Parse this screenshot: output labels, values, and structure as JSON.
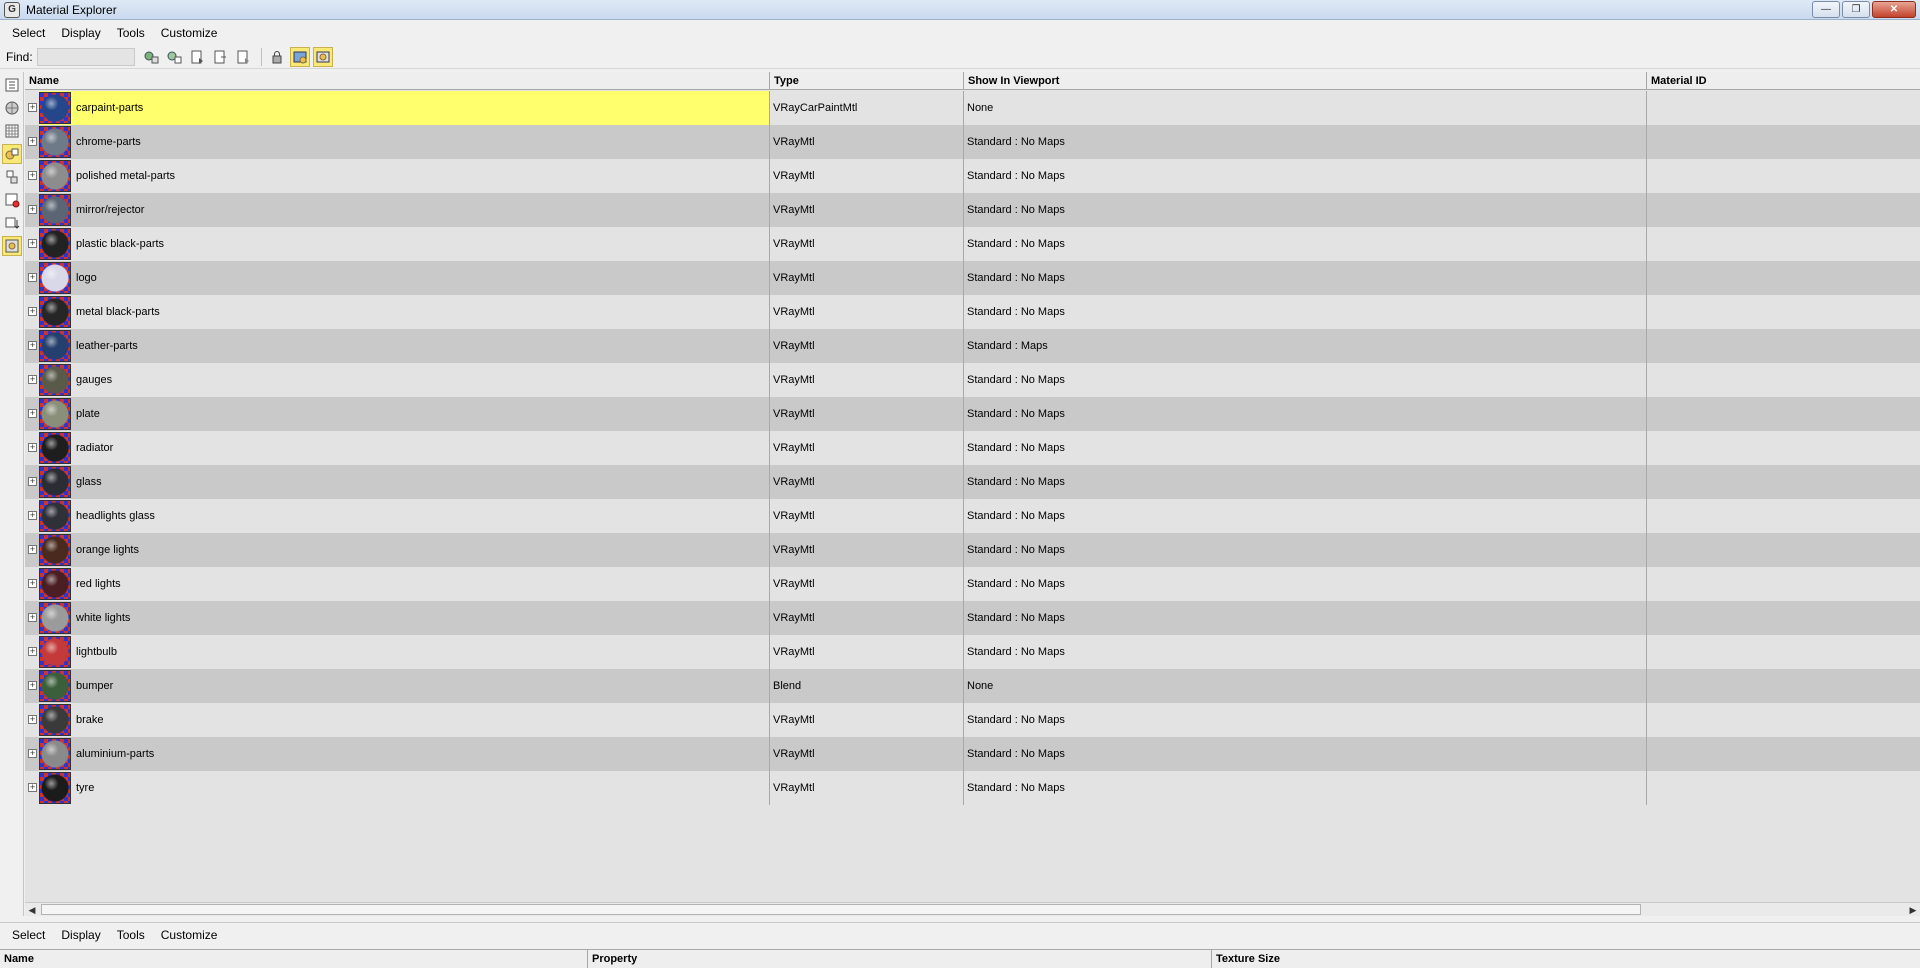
{
  "window": {
    "title": "Material Explorer",
    "minimize": "—",
    "restore": "❐",
    "close": "✕"
  },
  "menu": [
    "Select",
    "Display",
    "Tools",
    "Customize"
  ],
  "toolbar": {
    "find_label": "Find:",
    "find_value": ""
  },
  "columns": {
    "name": "Name",
    "type": "Type",
    "viewport": "Show In Viewport",
    "material_id": "Material ID"
  },
  "materials": [
    {
      "name": "carpaint-parts",
      "type": "VRayCarPaintMtl",
      "viewport": "None",
      "material_id": "",
      "selected": true,
      "swatch": "#24468a"
    },
    {
      "name": "chrome-parts",
      "type": "VRayMtl",
      "viewport": "Standard : No Maps",
      "material_id": "",
      "swatch": "#6f7a88"
    },
    {
      "name": "polished metal-parts",
      "type": "VRayMtl",
      "viewport": "Standard : No Maps",
      "material_id": "",
      "swatch": "#8d8d8d"
    },
    {
      "name": "mirror/rejector",
      "type": "VRayMtl",
      "viewport": "Standard : No Maps",
      "material_id": "",
      "swatch": "#5c6574"
    },
    {
      "name": "plastic black-parts",
      "type": "VRayMtl",
      "viewport": "Standard : No Maps",
      "material_id": "",
      "swatch": "#222222"
    },
    {
      "name": "logo",
      "type": "VRayMtl",
      "viewport": "Standard : No Maps",
      "material_id": "",
      "swatch": "#d8d8e8"
    },
    {
      "name": "metal black-parts",
      "type": "VRayMtl",
      "viewport": "Standard : No Maps",
      "material_id": "",
      "swatch": "#262626"
    },
    {
      "name": "leather-parts",
      "type": "VRayMtl",
      "viewport": "Standard : Maps",
      "material_id": "",
      "swatch": "#25406e"
    },
    {
      "name": "gauges",
      "type": "VRayMtl",
      "viewport": "Standard : No Maps",
      "material_id": "",
      "swatch": "#5a5a4a"
    },
    {
      "name": "plate",
      "type": "VRayMtl",
      "viewport": "Standard : No Maps",
      "material_id": "",
      "swatch": "#8a8f7a"
    },
    {
      "name": "radiator",
      "type": "VRayMtl",
      "viewport": "Standard : No Maps",
      "material_id": "",
      "swatch": "#1e1e1e"
    },
    {
      "name": "glass",
      "type": "VRayMtl",
      "viewport": "Standard : No Maps",
      "material_id": "",
      "swatch": "#2a2d33"
    },
    {
      "name": "headlights glass",
      "type": "VRayMtl",
      "viewport": "Standard : No Maps",
      "material_id": "",
      "swatch": "#2e3138"
    },
    {
      "name": "orange lights",
      "type": "VRayMtl",
      "viewport": "Standard : No Maps",
      "material_id": "",
      "swatch": "#4a2a1e"
    },
    {
      "name": "red lights",
      "type": "VRayMtl",
      "viewport": "Standard : No Maps",
      "material_id": "",
      "swatch": "#4a1e22"
    },
    {
      "name": "white lights",
      "type": "VRayMtl",
      "viewport": "Standard : No Maps",
      "material_id": "",
      "swatch": "#9b9b9b"
    },
    {
      "name": "lightbulb",
      "type": "VRayMtl",
      "viewport": "Standard : No Maps",
      "material_id": "",
      "swatch": "#c43a3a"
    },
    {
      "name": "bumper",
      "type": "Blend",
      "viewport": "None",
      "material_id": "",
      "swatch": "#3a5f3a"
    },
    {
      "name": "brake",
      "type": "VRayMtl",
      "viewport": "Standard : No Maps",
      "material_id": "",
      "swatch": "#3a3a3a"
    },
    {
      "name": "aluminium-parts",
      "type": "VRayMtl",
      "viewport": "Standard : No Maps",
      "material_id": "",
      "swatch": "#8a8a8a"
    },
    {
      "name": "tyre",
      "type": "VRayMtl",
      "viewport": "Standard : No Maps",
      "material_id": "",
      "swatch": "#1b1b1b"
    }
  ],
  "bottom": {
    "menu": [
      "Select",
      "Display",
      "Tools",
      "Customize"
    ],
    "columns": {
      "name": "Name",
      "property": "Property",
      "texture_size": "Texture Size"
    }
  },
  "colors": {
    "selection": "#ffff6e",
    "row_odd": "#e3e3e3",
    "row_even": "#c9c9c9",
    "active_tool": "#f8e977"
  }
}
